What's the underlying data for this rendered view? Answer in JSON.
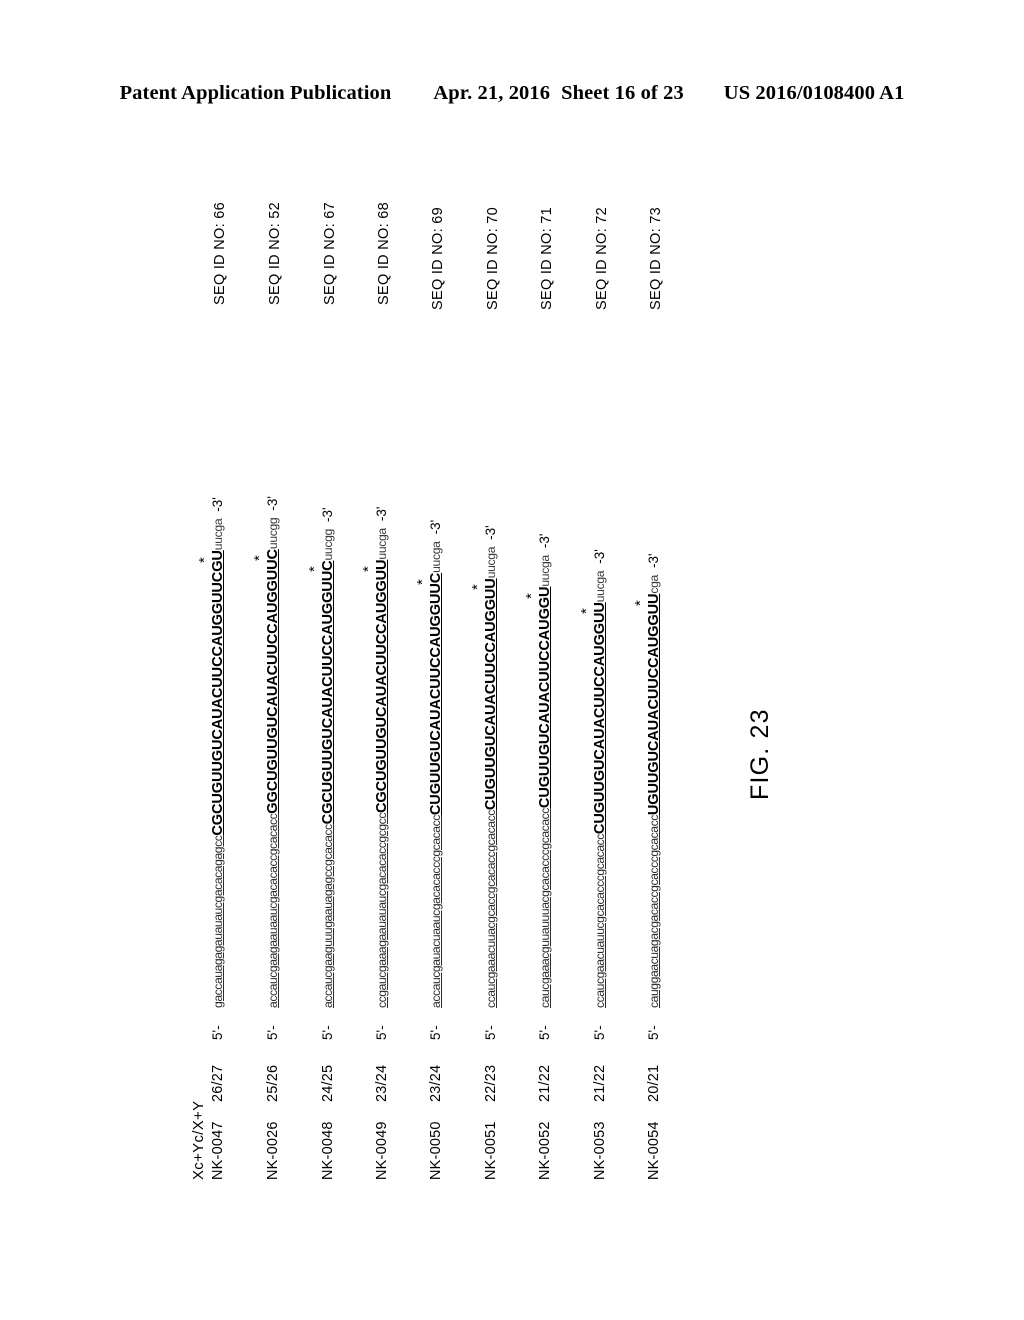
{
  "header": {
    "publication": "Patent Application Publication",
    "date": "Apr. 21, 2016",
    "sheet": "Sheet 16 of 23",
    "patent_number": "US 2016/0108400 A1"
  },
  "figure": {
    "caption": "FIG. 23",
    "column_header": "Xc+Yc/X+Y",
    "five_prime": "5'-",
    "three_prime": "-3'",
    "star": "*"
  },
  "rows": [
    {
      "id": "NK-0047",
      "ratio": "26/27",
      "seq_lower": "gaccauagagauauaucgacacagagcc",
      "seq_upper": "CGCUGUUGUCAUACUUCCAUGGUUCGU",
      "seq_tail": "uucga",
      "seq_id": "SEQ ID NO: 66"
    },
    {
      "id": "NK-0026",
      "ratio": "25/26",
      "seq_lower": "accaucgaagaauaaucgacacaccgcacacc",
      "seq_upper": "GGCUGUUGUCAUACUUCCAUGGUUC",
      "seq_tail": "uucgg",
      "seq_id": "SEQ ID NO: 52"
    },
    {
      "id": "NK-0048",
      "ratio": "24/25",
      "seq_lower": "accaucgaaguuugaauagagccgcacacc",
      "seq_upper": "CGCUGUUGUCAUACUUCCAUGGUUC",
      "seq_tail": "uucgg",
      "seq_id": "SEQ ID NO: 67"
    },
    {
      "id": "NK-0049",
      "ratio": "23/24",
      "seq_lower": "ccgaucgaaagaauauaucgacacaccgcgcc",
      "seq_upper": "CGCUGUUGUCAUACUUCCAUGGUU",
      "seq_tail": "uucga",
      "seq_id": "SEQ ID NO: 68"
    },
    {
      "id": "NK-0050",
      "ratio": "23/24",
      "seq_lower": "accaucgauacuaaucgacacacccgcacacc",
      "seq_upper": "CUGUUGUCAUACUUCCAUGGUUC",
      "seq_tail": "uucga",
      "seq_id": "SEQ ID NO: 69"
    },
    {
      "id": "NK-0051",
      "ratio": "22/23",
      "seq_lower": "ccaucgaaacuuacgcaccgcacaccgcacacc",
      "seq_upper": "CUGUUGUCAUACUUCCAUGGUU",
      "seq_tail": "uucga",
      "seq_id": "SEQ ID NO: 70"
    },
    {
      "id": "NK-0052",
      "ratio": "21/22",
      "seq_lower": "caucgaaacguuauuuacgcacacccgcacacc",
      "seq_upper": "CUGUUGUCAUACUUCCAUGGU",
      "seq_tail": "uucga",
      "seq_id": "SEQ ID NO: 71"
    },
    {
      "id": "NK-0053",
      "ratio": "21/22",
      "seq_lower": "ccaucgaacuauucgcacacccgcacacc",
      "seq_upper": "CUGUUGUCAUACUUCCAUGGUU",
      "seq_tail": "uucga",
      "seq_id": "SEQ ID NO: 72"
    },
    {
      "id": "NK-0054",
      "ratio": "20/21",
      "seq_lower": "cauggaacuagacgacaccgcacccgcacacc",
      "seq_upper": "UGUUGUCAUACUUCCAUGGUU",
      "seq_tail": "cga",
      "seq_id": "SEQ ID NO: 73"
    }
  ]
}
